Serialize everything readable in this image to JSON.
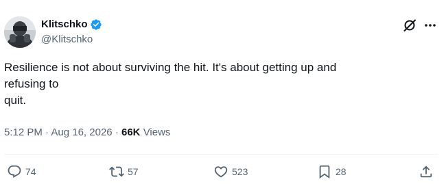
{
  "author": {
    "display_name": "Klitschko",
    "handle": "@Klitschko",
    "verified": true,
    "verified_color": "#1d9bf0",
    "avatar_icon": "avatar-photo"
  },
  "header_actions": {
    "grok_icon": "grok-icon",
    "more_icon": "more-icon"
  },
  "tweet": {
    "lines": [
      "Resilience is not about surviving the hit. It's about getting up and",
      "refusing to",
      "quit."
    ]
  },
  "meta": {
    "time": "5:12 PM",
    "separator": "·",
    "date": "Aug 16, 2026",
    "views_count": "66K",
    "views_label": "Views"
  },
  "actions": {
    "reply": {
      "icon": "reply-icon",
      "count": "74"
    },
    "retweet": {
      "icon": "retweet-icon",
      "count": "57"
    },
    "like": {
      "icon": "heart-icon",
      "count": "523"
    },
    "bookmark": {
      "icon": "bookmark-icon",
      "count": "28"
    },
    "share": {
      "icon": "share-icon"
    }
  },
  "colors": {
    "text_primary": "#0f1419",
    "text_secondary": "#536471",
    "divider": "#eff3f4"
  }
}
